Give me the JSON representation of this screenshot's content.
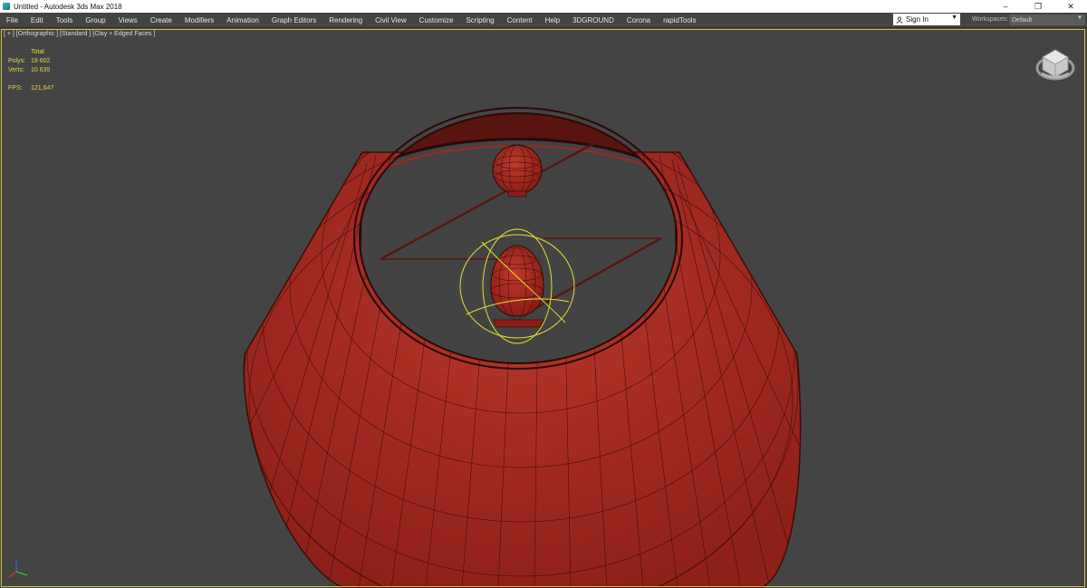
{
  "window": {
    "title": "Untitled - Autodesk 3ds Max 2018"
  },
  "window_controls": {
    "minimize": "–",
    "maximize": "❐",
    "close": "✕"
  },
  "menu": [
    "File",
    "Edit",
    "Tools",
    "Group",
    "Views",
    "Create",
    "Modifiers",
    "Animation",
    "Graph Editors",
    "Rendering",
    "Civil View",
    "Customize",
    "Scripting",
    "Content",
    "Help",
    "3DGROUND",
    "Corona",
    "rapidTools"
  ],
  "signin": {
    "label": "Sign In"
  },
  "workspaces": {
    "label": "Workspaces:",
    "value": "Default"
  },
  "viewport": {
    "label": "[ + ] [Orthographic ] [Standard ] [Clay + Edged Faces ]"
  },
  "stats": {
    "header": "Total",
    "polys_label": "Polys:",
    "polys_value": "19 602",
    "verts_label": "Verts:",
    "verts_value": "10 635",
    "fps_label": "FPS:",
    "fps_value": "121,647"
  },
  "colors": {
    "viewport_bg": "#444444",
    "clay": "#a8291f",
    "wire": "#2b0807",
    "selection": "#e6e031",
    "stats_text": "#e0d64a"
  },
  "icons": {
    "app": "3ds-max-icon",
    "viewcube": "viewcube-icon",
    "axis": "axis-tripod-icon"
  }
}
